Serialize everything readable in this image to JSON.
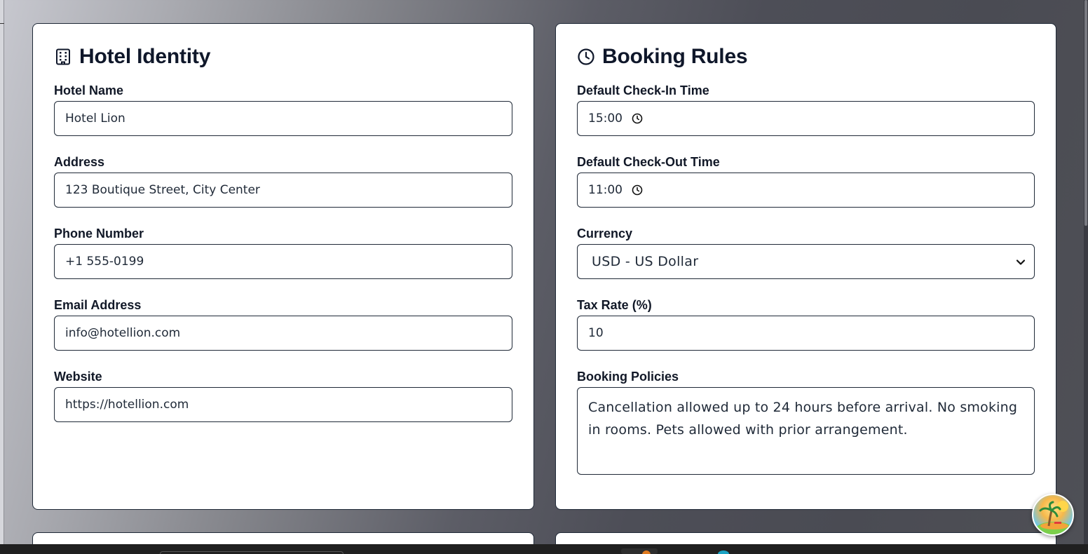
{
  "hotel_identity": {
    "title": "Hotel Identity",
    "icon": "building-icon",
    "fields": {
      "hotel_name": {
        "label": "Hotel Name",
        "value": "Hotel Lion"
      },
      "address": {
        "label": "Address",
        "value": "123 Boutique Street, City Center"
      },
      "phone": {
        "label": "Phone Number",
        "value": "+1 555-0199"
      },
      "email": {
        "label": "Email Address",
        "value": "info@hotellion.com"
      },
      "website": {
        "label": "Website",
        "value": "https://hotellion.com"
      }
    }
  },
  "booking_rules": {
    "title": "Booking Rules",
    "icon": "clock-icon",
    "fields": {
      "check_in": {
        "label": "Default Check-In Time",
        "value": "15:00"
      },
      "check_out": {
        "label": "Default Check-Out Time",
        "value": "11:00"
      },
      "currency": {
        "label": "Currency",
        "value": "USD - US Dollar"
      },
      "tax_rate": {
        "label": "Tax Rate (%)",
        "value": "10"
      },
      "policies": {
        "label": "Booking Policies",
        "value": "Cancellation allowed up to 24 hours before arrival. No smoking in rooms. Pets allowed with prior arrangement."
      }
    }
  },
  "colors": {
    "card_border": "#1f2937",
    "title_text": "#0f172a",
    "body_text": "#1f2937"
  }
}
